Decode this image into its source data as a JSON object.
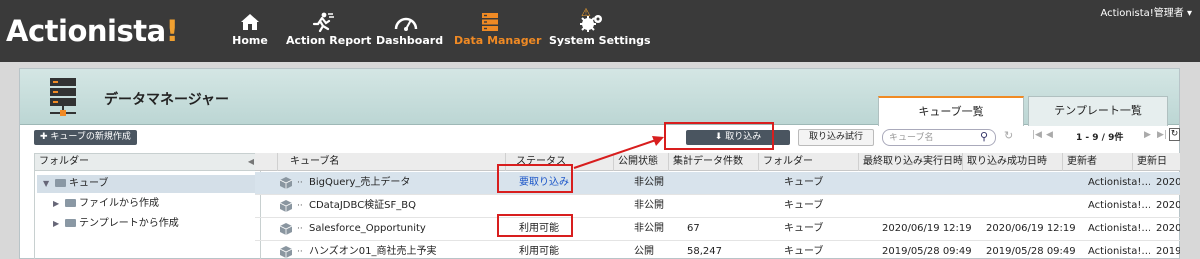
{
  "app": {
    "brand_main": "Actionista",
    "brand_bang": "!",
    "user_menu": "Actionista!管理者 ▾"
  },
  "nav": [
    {
      "label": "Home",
      "icon": "home-icon"
    },
    {
      "label": "Action Report",
      "icon": "runner-icon"
    },
    {
      "label": "Dashboard",
      "icon": "gauge-icon"
    },
    {
      "label": "Data Manager",
      "icon": "database-icon",
      "active": true
    },
    {
      "label": "System Settings",
      "icon": "gears-icon",
      "badge": "⚠"
    }
  ],
  "page": {
    "title": "データマネージャー",
    "tabs": [
      {
        "label": "キューブ一覧",
        "active": true
      },
      {
        "label": "テンプレート一覧",
        "active": false
      }
    ]
  },
  "toolbar": {
    "new_cube": "✚ キューブの新規作成",
    "import": "⬇  取り込み",
    "import_trial": "取り込み試行",
    "search_placeholder": "キューブ名",
    "pager": "1 - 9 / 9件",
    "first": "|◀",
    "prev": "◀",
    "next": "▶",
    "last": "▶|",
    "refresh": "↻",
    "reload": "↻"
  },
  "folders": {
    "header": "フォルダー",
    "collapse": "◀",
    "tree": [
      {
        "label": "キューブ",
        "expanded": true
      },
      {
        "label": "ファイルから作成",
        "expanded": false
      },
      {
        "label": "テンプレートから作成",
        "expanded": false
      }
    ]
  },
  "table": {
    "columns": [
      "キューブ名",
      "ステータス",
      "公開状態",
      "集計データ件数",
      "フォルダー",
      "最終取り込み実行日時",
      "取り込み成功日時",
      "更新者",
      "更新日"
    ],
    "rows": [
      [
        "BigQuery_売上データ",
        "要取り込み",
        "非公開",
        "",
        "キューブ",
        "",
        "",
        "Actionista!…",
        "2020/"
      ],
      [
        "CDataJDBC検証SF_BQ",
        "",
        "非公開",
        "",
        "キューブ",
        "",
        "",
        "Actionista!…",
        "2020/"
      ],
      [
        "Salesforce_Opportunity",
        "利用可能",
        "非公開",
        "67",
        "キューブ",
        "2020/06/19 12:19",
        "2020/06/19 12:19",
        "Actionista!…",
        "2020/"
      ],
      [
        "ハンズオン01_商社売上予実",
        "利用可能",
        "公開",
        "58,247",
        "キューブ",
        "2019/05/28 09:49",
        "2019/05/28 09:49",
        "Actionista!…",
        "2019/"
      ]
    ]
  },
  "colors": {
    "accent": "#f08a24",
    "annotation_red": "#d81e1e",
    "link_blue": "#1a55c8"
  }
}
